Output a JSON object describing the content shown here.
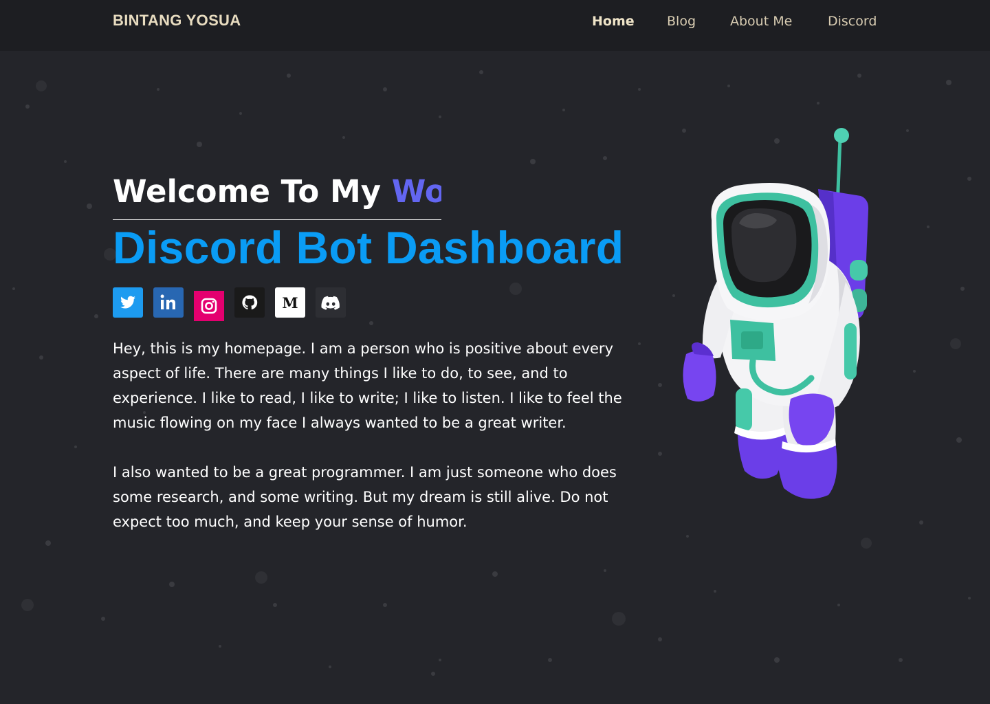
{
  "nav": {
    "brand": "BINTANG YOSUA",
    "links": [
      {
        "label": "Home",
        "active": true
      },
      {
        "label": "Blog",
        "active": false
      },
      {
        "label": "About Me",
        "active": false
      },
      {
        "label": "Discord",
        "active": false
      }
    ]
  },
  "hero": {
    "welcome_prefix": "Welcome To My",
    "welcome_accent": "World",
    "title": "Discord Bot Dashboard",
    "paragraph1": "Hey, this is my homepage. I am a person who is positive about every aspect of life. There are many things I like to do, to see, and to experience. I like to read, I like to write; I like to listen. I like to feel the music flowing on my face I always wanted to be a great writer.",
    "paragraph2": "I also wanted to be a great programmer. I am just someone who does some research, and some writing. But my dream is still alive. Do not expect too much, and keep your sense of humor."
  },
  "social": [
    {
      "name": "twitter",
      "icon": "twitter-icon",
      "color": "#1d9bf0"
    },
    {
      "name": "linkedin",
      "icon": "linkedin-icon",
      "color": "#2867b2"
    },
    {
      "name": "instagram",
      "icon": "instagram-icon",
      "color": "#e4006f"
    },
    {
      "name": "github",
      "icon": "github-icon",
      "color": "#1a1a1a"
    },
    {
      "name": "medium",
      "icon": "medium-icon",
      "color": "#ffffff"
    },
    {
      "name": "discord",
      "icon": "discord-icon",
      "color": "#2d2e33"
    }
  ],
  "illustration": {
    "icon": "astronaut-icon"
  },
  "colors": {
    "background": "#24252a",
    "navbar": "#1d1e22",
    "brand": "#e8dcc0",
    "title": "#0a9cf5",
    "accent": "#6366f1"
  }
}
